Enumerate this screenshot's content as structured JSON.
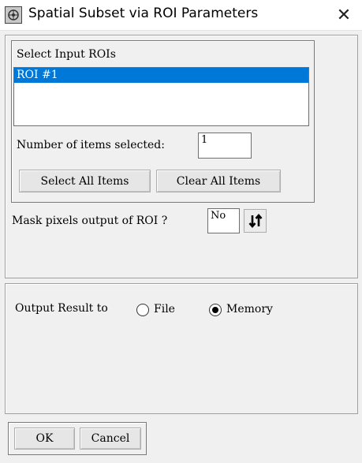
{
  "window": {
    "title": "Spatial Subset via ROI Parameters",
    "icon": "app-icon",
    "close_glyph": "✕"
  },
  "roi_group": {
    "label": "Select Input ROIs",
    "items": [
      {
        "label": "ROI #1",
        "selected": true
      }
    ],
    "count_label": "Number of items selected:",
    "count_value": "1",
    "select_all_label": "Select All Items",
    "clear_all_label": "Clear All Items"
  },
  "mask": {
    "label": "Mask pixels output of ROI ?",
    "value": "No",
    "toggle_icon": "up-down-arrows-icon"
  },
  "output": {
    "label": "Output Result to",
    "options": [
      {
        "label": "File",
        "selected": false
      },
      {
        "label": "Memory",
        "selected": true
      }
    ]
  },
  "buttons": {
    "ok_label": "OK",
    "cancel_label": "Cancel"
  },
  "colors": {
    "selection": "#0078d7",
    "background": "#f0f0f0"
  }
}
